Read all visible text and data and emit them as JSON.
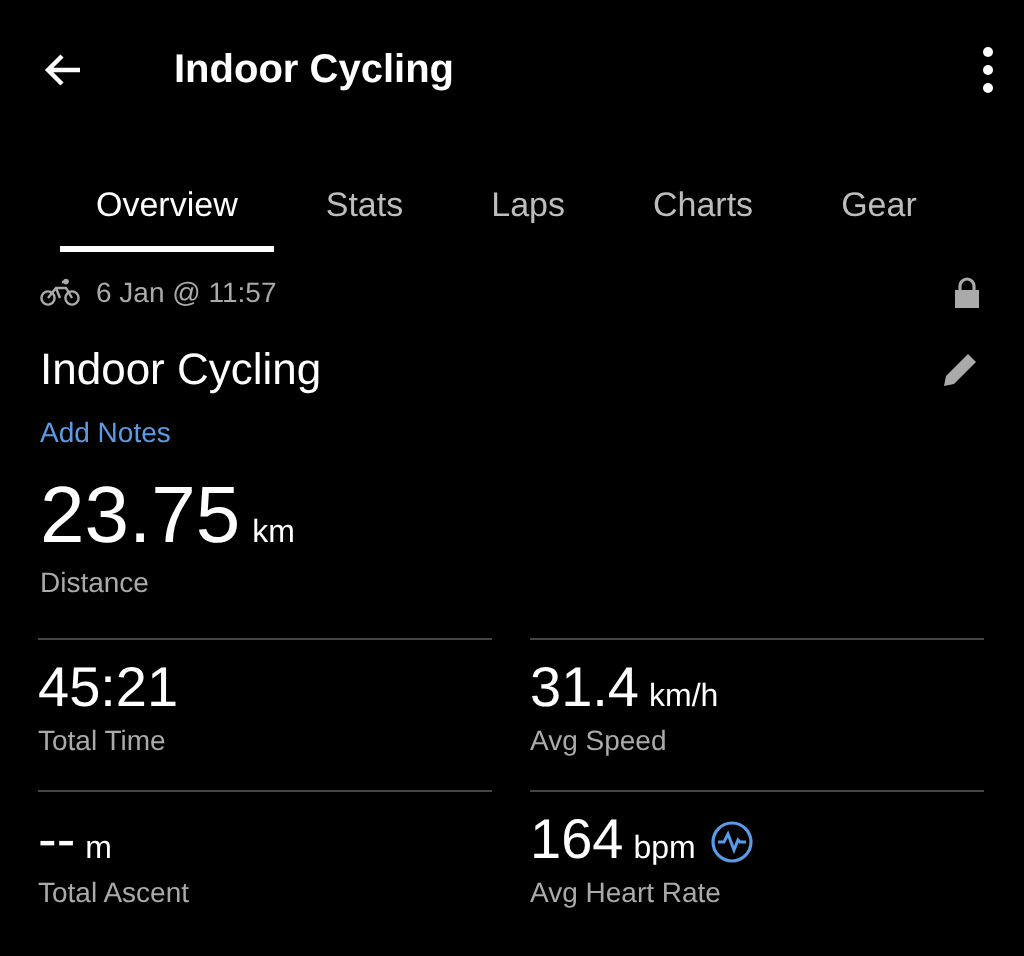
{
  "app_bar": {
    "title": "Indoor Cycling"
  },
  "tabs": [
    {
      "label": "Overview",
      "selected": true
    },
    {
      "label": "Stats",
      "selected": false
    },
    {
      "label": "Laps",
      "selected": false
    },
    {
      "label": "Charts",
      "selected": false
    },
    {
      "label": "Gear",
      "selected": false
    }
  ],
  "activity": {
    "date": "6 Jan @ 11:57",
    "name": "Indoor Cycling",
    "notes_link": "Add Notes"
  },
  "distance": {
    "value": "23.75",
    "unit": "km",
    "label": "Distance"
  },
  "stats": [
    {
      "kind": "plain",
      "value": "45:21",
      "label": "Total Time"
    },
    {
      "kind": "plain",
      "value": "--",
      "unit": "m",
      "label": "Total Ascent"
    },
    {
      "kind": "plain",
      "value": "31.4",
      "unit": "km/h",
      "label": "Avg Speed"
    },
    {
      "kind": "heart_rate",
      "value": "164",
      "unit": "bpm",
      "label": "Avg Heart Rate"
    }
  ]
}
